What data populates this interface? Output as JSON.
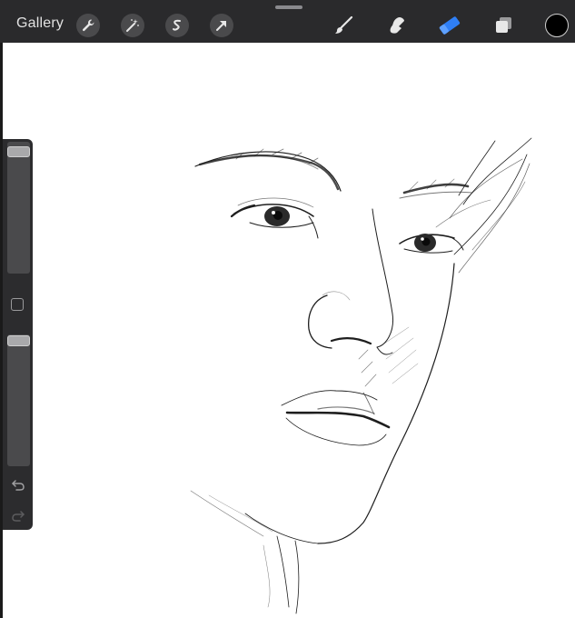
{
  "app": {
    "gallery_label": "Gallery"
  },
  "toolbar": {
    "actions": [
      "wrench-icon",
      "magic-wand-icon",
      "selection-icon",
      "transform-arrow-icon"
    ],
    "tools": [
      "brush-icon",
      "smudge-icon",
      "eraser-icon",
      "layers-icon"
    ],
    "active_tool": "eraser",
    "current_color": "#000000",
    "accent_color": "#2f7ff6"
  },
  "sidebar": {
    "brush_size": 0.97,
    "brush_opacity": 1.0,
    "buttons": [
      "modify-button",
      "undo-arrow-icon",
      "redo-arrow-icon"
    ]
  },
  "canvas": {
    "content": "pencil-sketch"
  }
}
